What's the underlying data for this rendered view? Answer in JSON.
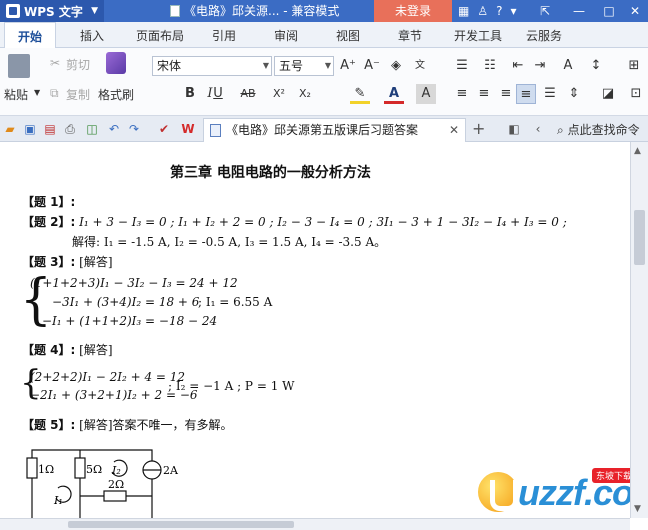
{
  "app": {
    "name": "WPS 文字",
    "title": "《电路》邱关源...  - 兼容模式",
    "login": "未登录"
  },
  "tabs": [
    "开始",
    "插入",
    "页面布局",
    "引用",
    "审阅",
    "视图",
    "章节",
    "开发工具",
    "云服务"
  ],
  "ribbon": {
    "paste": "粘贴",
    "cut": "剪切",
    "copy": "复制",
    "format_painter": "格式刷",
    "font_name": "宋体",
    "font_size": "五号",
    "bold": "B",
    "italic": "I",
    "underline": "U",
    "strike": "AB",
    "superscript": "X²",
    "subscript": "X₂"
  },
  "document_tab": {
    "title": "《电路》邱关源第五版课后习题答案"
  },
  "help_search": "点此查找命令",
  "doc": {
    "heading": "第三章      电阻电路的一般分析方法",
    "q1": "【题 1】:",
    "q2_label": "【题 2】:",
    "q2_eqs": "I₁ + 3 − I₃ = 0 ;  I₁ + I₂ + 2 = 0 ;  I₂ − 3 − I₄ = 0 ;  3I₁ − 3 + 1 − 3I₂ − I₄ + I₃ = 0 ;",
    "q2_sol": "解得:  I₁ = -1.5 A,  I₂ = -0.5 A,  I₃ = 1.5 A,  I₄ = -3.5 A。",
    "q3_label": "【题 3】:",
    "q3_tag": "[解答]",
    "q3_eq1": "(1+1+2+3)I₁ − 3I₂ − I₃ = 24 + 12",
    "q3_eq2": "−3I₁ + (3+4)I₂ = 18 + 6",
    "q3_eq3": "−I₁ + (1+1+2)I₃ = −18 − 24",
    "q3_result": ";  I₁ = 6.55 A",
    "q4_label": "【题 4】:",
    "q4_tag": "[解答]",
    "q4_eq1": "(2+2+2)I₁ − 2I₂ + 4 = 12",
    "q4_eq2": "−2I₁ + (3+2+1)I₂ + 2 = −6",
    "q4_result": ";  I₂ = −1  A ;   P = 1  W",
    "q5_label": "【题 5】:",
    "q5_text": "[解答]答案不唯一，有多解。",
    "circuit": {
      "r1": "1Ω",
      "r2": "5Ω",
      "r3": "2Ω",
      "src": "2A",
      "i1": "I₁",
      "i2": "I₂"
    }
  },
  "watermark": {
    "text": "uzzf.com",
    "badge": "东坡下载"
  }
}
